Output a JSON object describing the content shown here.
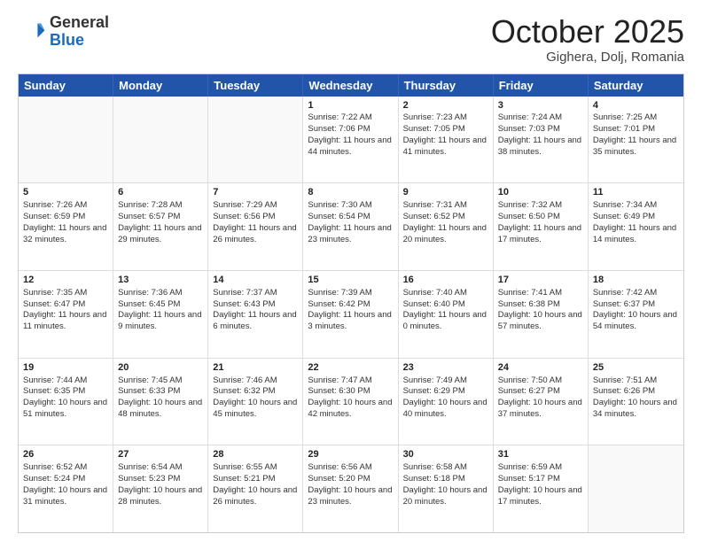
{
  "header": {
    "logo_general": "General",
    "logo_blue": "Blue",
    "month_title": "October 2025",
    "location": "Gighera, Dolj, Romania"
  },
  "days_of_week": [
    "Sunday",
    "Monday",
    "Tuesday",
    "Wednesday",
    "Thursday",
    "Friday",
    "Saturday"
  ],
  "weeks": [
    [
      {
        "day": "",
        "text": ""
      },
      {
        "day": "",
        "text": ""
      },
      {
        "day": "",
        "text": ""
      },
      {
        "day": "1",
        "text": "Sunrise: 7:22 AM\nSunset: 7:06 PM\nDaylight: 11 hours and 44 minutes."
      },
      {
        "day": "2",
        "text": "Sunrise: 7:23 AM\nSunset: 7:05 PM\nDaylight: 11 hours and 41 minutes."
      },
      {
        "day": "3",
        "text": "Sunrise: 7:24 AM\nSunset: 7:03 PM\nDaylight: 11 hours and 38 minutes."
      },
      {
        "day": "4",
        "text": "Sunrise: 7:25 AM\nSunset: 7:01 PM\nDaylight: 11 hours and 35 minutes."
      }
    ],
    [
      {
        "day": "5",
        "text": "Sunrise: 7:26 AM\nSunset: 6:59 PM\nDaylight: 11 hours and 32 minutes."
      },
      {
        "day": "6",
        "text": "Sunrise: 7:28 AM\nSunset: 6:57 PM\nDaylight: 11 hours and 29 minutes."
      },
      {
        "day": "7",
        "text": "Sunrise: 7:29 AM\nSunset: 6:56 PM\nDaylight: 11 hours and 26 minutes."
      },
      {
        "day": "8",
        "text": "Sunrise: 7:30 AM\nSunset: 6:54 PM\nDaylight: 11 hours and 23 minutes."
      },
      {
        "day": "9",
        "text": "Sunrise: 7:31 AM\nSunset: 6:52 PM\nDaylight: 11 hours and 20 minutes."
      },
      {
        "day": "10",
        "text": "Sunrise: 7:32 AM\nSunset: 6:50 PM\nDaylight: 11 hours and 17 minutes."
      },
      {
        "day": "11",
        "text": "Sunrise: 7:34 AM\nSunset: 6:49 PM\nDaylight: 11 hours and 14 minutes."
      }
    ],
    [
      {
        "day": "12",
        "text": "Sunrise: 7:35 AM\nSunset: 6:47 PM\nDaylight: 11 hours and 11 minutes."
      },
      {
        "day": "13",
        "text": "Sunrise: 7:36 AM\nSunset: 6:45 PM\nDaylight: 11 hours and 9 minutes."
      },
      {
        "day": "14",
        "text": "Sunrise: 7:37 AM\nSunset: 6:43 PM\nDaylight: 11 hours and 6 minutes."
      },
      {
        "day": "15",
        "text": "Sunrise: 7:39 AM\nSunset: 6:42 PM\nDaylight: 11 hours and 3 minutes."
      },
      {
        "day": "16",
        "text": "Sunrise: 7:40 AM\nSunset: 6:40 PM\nDaylight: 11 hours and 0 minutes."
      },
      {
        "day": "17",
        "text": "Sunrise: 7:41 AM\nSunset: 6:38 PM\nDaylight: 10 hours and 57 minutes."
      },
      {
        "day": "18",
        "text": "Sunrise: 7:42 AM\nSunset: 6:37 PM\nDaylight: 10 hours and 54 minutes."
      }
    ],
    [
      {
        "day": "19",
        "text": "Sunrise: 7:44 AM\nSunset: 6:35 PM\nDaylight: 10 hours and 51 minutes."
      },
      {
        "day": "20",
        "text": "Sunrise: 7:45 AM\nSunset: 6:33 PM\nDaylight: 10 hours and 48 minutes."
      },
      {
        "day": "21",
        "text": "Sunrise: 7:46 AM\nSunset: 6:32 PM\nDaylight: 10 hours and 45 minutes."
      },
      {
        "day": "22",
        "text": "Sunrise: 7:47 AM\nSunset: 6:30 PM\nDaylight: 10 hours and 42 minutes."
      },
      {
        "day": "23",
        "text": "Sunrise: 7:49 AM\nSunset: 6:29 PM\nDaylight: 10 hours and 40 minutes."
      },
      {
        "day": "24",
        "text": "Sunrise: 7:50 AM\nSunset: 6:27 PM\nDaylight: 10 hours and 37 minutes."
      },
      {
        "day": "25",
        "text": "Sunrise: 7:51 AM\nSunset: 6:26 PM\nDaylight: 10 hours and 34 minutes."
      }
    ],
    [
      {
        "day": "26",
        "text": "Sunrise: 6:52 AM\nSunset: 5:24 PM\nDaylight: 10 hours and 31 minutes."
      },
      {
        "day": "27",
        "text": "Sunrise: 6:54 AM\nSunset: 5:23 PM\nDaylight: 10 hours and 28 minutes."
      },
      {
        "day": "28",
        "text": "Sunrise: 6:55 AM\nSunset: 5:21 PM\nDaylight: 10 hours and 26 minutes."
      },
      {
        "day": "29",
        "text": "Sunrise: 6:56 AM\nSunset: 5:20 PM\nDaylight: 10 hours and 23 minutes."
      },
      {
        "day": "30",
        "text": "Sunrise: 6:58 AM\nSunset: 5:18 PM\nDaylight: 10 hours and 20 minutes."
      },
      {
        "day": "31",
        "text": "Sunrise: 6:59 AM\nSunset: 5:17 PM\nDaylight: 10 hours and 17 minutes."
      },
      {
        "day": "",
        "text": ""
      }
    ]
  ]
}
